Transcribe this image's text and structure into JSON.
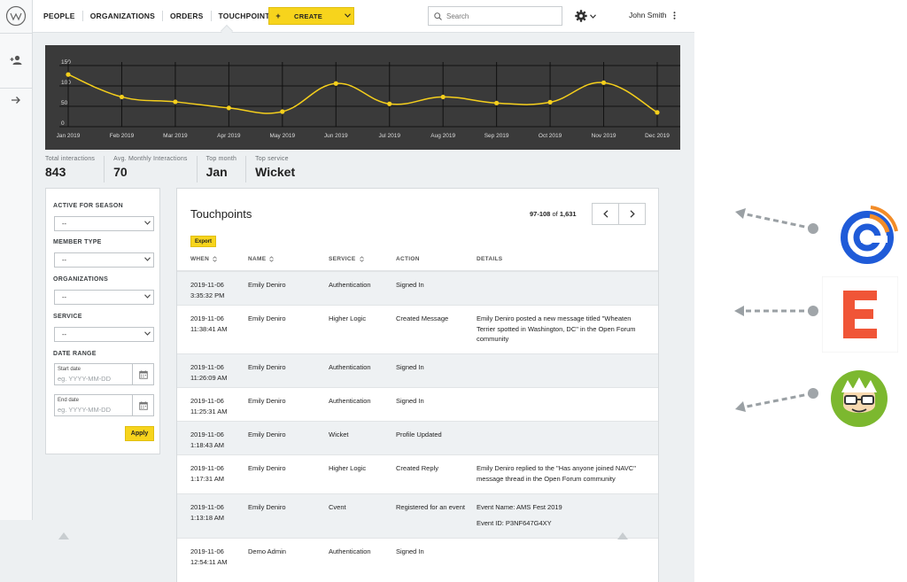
{
  "nav": {
    "items": [
      "PEOPLE",
      "ORGANIZATIONS",
      "ORDERS",
      "TOUCHPOINTS"
    ],
    "create_plus": "+",
    "create_label": "CREATE"
  },
  "search": {
    "placeholder": "Search"
  },
  "user": {
    "name": "John Smith"
  },
  "chart_data": {
    "type": "line",
    "categories": [
      "Jan 2019",
      "Feb 2019",
      "Mar 2019",
      "Apr 2019",
      "May 2019",
      "Jun 2019",
      "Jul 2019",
      "Aug 2019",
      "Sep 2019",
      "Oct 2019",
      "Nov 2019",
      "Dec 2019"
    ],
    "values": [
      128,
      73,
      61,
      46,
      37,
      106,
      56,
      73,
      58,
      60,
      108,
      35
    ],
    "yticks": [
      0,
      50,
      100,
      150
    ],
    "ylim": [
      0,
      150
    ],
    "grid": true,
    "line_color": "#f5cf1c",
    "background": "#3a3a3a"
  },
  "stats": [
    {
      "label": "Total interactions",
      "value": "843"
    },
    {
      "label": "Avg. Monthly Interactions",
      "value": "70"
    },
    {
      "label": "Top month",
      "value": "Jan"
    },
    {
      "label": "Top service",
      "value": "Wicket"
    }
  ],
  "filters": {
    "active_label": "ACTIVE FOR SEASON",
    "active_value": "--",
    "member_label": "MEMBER TYPE",
    "member_value": "--",
    "org_label": "ORGANIZATIONS",
    "org_value": "--",
    "service_label": "SERVICE",
    "service_value": "--",
    "date_label": "DATE RANGE",
    "start_label": "Start date",
    "start_placeholder": "eg. YYYY-MM-DD",
    "end_label": "End date",
    "end_placeholder": "eg. YYYY-MM-DD",
    "apply": "Apply"
  },
  "table": {
    "title": "Touchpoints",
    "range": "97-108",
    "of": "of",
    "total": "1,631",
    "export": "Export",
    "headers": {
      "when": "WHEN",
      "name": "NAME",
      "service": "SERVICE",
      "action": "ACTION",
      "details": "DETAILS"
    },
    "rows": [
      {
        "date": "2019-11-06",
        "time": "3:35:32 PM",
        "name": "Emily Deniro",
        "service": "Authentication",
        "action": "Signed In",
        "details": "",
        "details2": ""
      },
      {
        "date": "2019-11-06",
        "time": "11:38:41 AM",
        "name": "Emily Deniro",
        "service": "Higher Logic",
        "action": "Created Message",
        "details": "Emily Deniro posted a new message titled \"Wheaten Terrier spotted in Washington, DC\" in the Open Forum community",
        "details2": ""
      },
      {
        "date": "2019-11-06",
        "time": "11:26:09 AM",
        "name": "Emily Deniro",
        "service": "Authentication",
        "action": "Signed In",
        "details": "",
        "details2": ""
      },
      {
        "date": "2019-11-06",
        "time": "11:25:31 AM",
        "name": "Emily Deniro",
        "service": "Authentication",
        "action": "Signed In",
        "details": "",
        "details2": ""
      },
      {
        "date": "2019-11-06",
        "time": "1:18:43 AM",
        "name": "Emily Deniro",
        "service": "Wicket",
        "action": "Profile Updated",
        "details": "",
        "details2": ""
      },
      {
        "date": "2019-11-06",
        "time": "1:17:31 AM",
        "name": "Emily Deniro",
        "service": "Higher Logic",
        "action": "Created Reply",
        "details": "Emily Deniro replied to the \"Has anyone joined NAVC\" message thread in the Open Forum community",
        "details2": ""
      },
      {
        "date": "2019-11-06",
        "time": "1:13:18 AM",
        "name": "Emily Deniro",
        "service": "Cvent",
        "action": "Registered for an event",
        "details": "Event Name: AMS Fest 2019",
        "details2": "Event ID: P3NF647G4XY"
      },
      {
        "date": "2019-11-06",
        "time": "12:54:11 AM",
        "name": "Demo Admin",
        "service": "Authentication",
        "action": "Signed In",
        "details": "",
        "details2": ""
      }
    ]
  },
  "integrations": [
    {
      "name": "cvent-icon",
      "color": "#1f5bd8",
      "accent": "#f28c28"
    },
    {
      "name": "eventbrite-icon",
      "color": "#f05537"
    },
    {
      "name": "mailchimp-icon",
      "color": "#7cb82f"
    }
  ]
}
